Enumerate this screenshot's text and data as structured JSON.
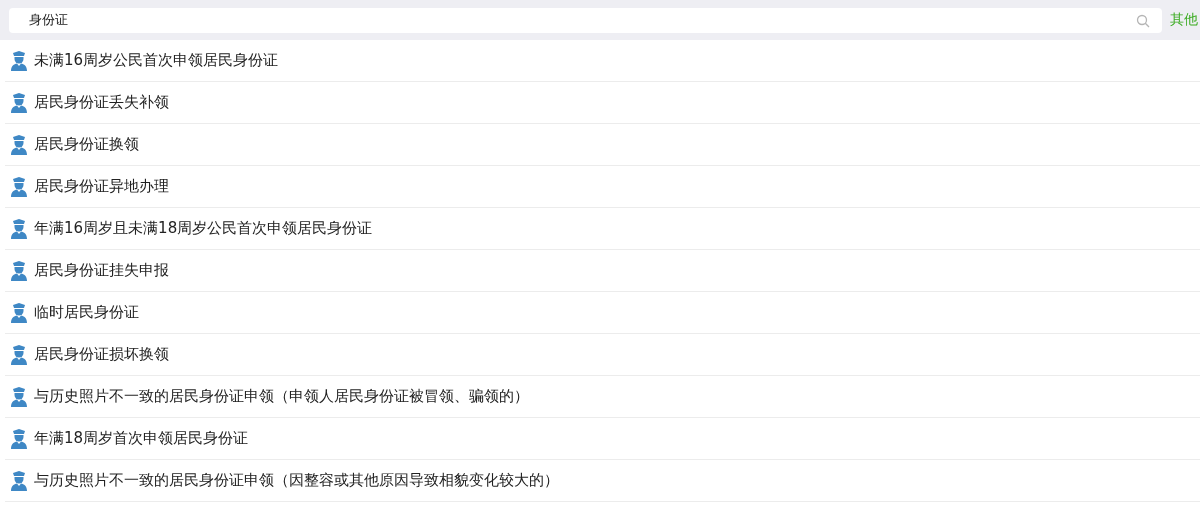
{
  "search": {
    "value": "身份证"
  },
  "other_button": "其他",
  "results": [
    {
      "label": "未满16周岁公民首次申领居民身份证"
    },
    {
      "label": "居民身份证丢失补领"
    },
    {
      "label": "居民身份证换领"
    },
    {
      "label": "居民身份证异地办理"
    },
    {
      "label": "年满16周岁且未满18周岁公民首次申领居民身份证"
    },
    {
      "label": "居民身份证挂失申报"
    },
    {
      "label": "临时居民身份证"
    },
    {
      "label": "居民身份证损坏换领"
    },
    {
      "label": "与历史照片不一致的居民身份证申领（申领人居民身份证被冒领、骗领的）"
    },
    {
      "label": "年满18周岁首次申领居民身份证"
    },
    {
      "label": "与历史照片不一致的居民身份证申领（因整容或其他原因导致相貌变化较大的）"
    }
  ]
}
